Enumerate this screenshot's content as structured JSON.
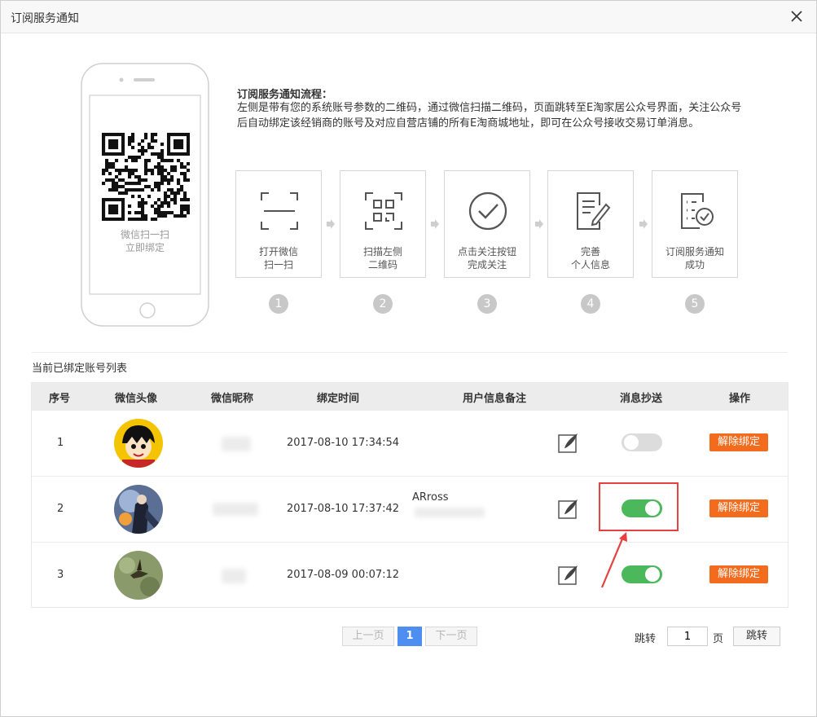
{
  "dialog": {
    "title": "订阅服务通知"
  },
  "phone": {
    "caption_line1": "微信扫一扫",
    "caption_line2": "立即绑定"
  },
  "flow": {
    "title": "订阅服务通知流程：",
    "description": "左侧是带有您的系统账号参数的二维码，通过微信扫描二维码，页面跳转至E淘家居公众号界面，关注公众号后自动绑定该经销商的账号及对应自营店铺的所有E淘商城地址，即可在公众号接收交易订单消息。",
    "steps": [
      {
        "line1": "打开微信",
        "line2": "扫一扫",
        "num": "1",
        "icon": "scan-frame-icon"
      },
      {
        "line1": "扫描左侧",
        "line2": "二维码",
        "num": "2",
        "icon": "qr-code-icon"
      },
      {
        "line1": "点击关注按钮",
        "line2": "完成关注",
        "num": "3",
        "icon": "check-circle-icon"
      },
      {
        "line1": "完善",
        "line2": "个人信息",
        "num": "4",
        "icon": "edit-document-icon"
      },
      {
        "line1": "订阅服务通知",
        "line2": "成功",
        "num": "5",
        "icon": "checklist-icon"
      }
    ]
  },
  "list": {
    "title": "当前已绑定账号列表",
    "headers": {
      "index": "序号",
      "avatar": "微信头像",
      "nickname": "微信昵称",
      "bind_time": "绑定时间",
      "note": "用户信息备注",
      "cc": "消息抄送",
      "action": "操作"
    },
    "rows": [
      {
        "index": "1",
        "time": "2017-08-10 17:34:54",
        "note": "",
        "cc_on": false,
        "action": "解除绑定"
      },
      {
        "index": "2",
        "time": "2017-08-10 17:37:42",
        "note": "ARross",
        "cc_on": true,
        "action": "解除绑定"
      },
      {
        "index": "3",
        "time": "2017-08-09 00:07:12",
        "note": "",
        "cc_on": true,
        "action": "解除绑定"
      }
    ]
  },
  "pager": {
    "prev": "上一页",
    "current": "1",
    "next": "下一页",
    "jump_label": "跳转",
    "page_value": "1",
    "page_unit": "页",
    "jump_button": "跳转"
  },
  "colors": {
    "accent_orange": "#f36b1c",
    "toggle_on": "#4cb85c",
    "page_current": "#4d8ef0",
    "highlight": "#e64040"
  }
}
